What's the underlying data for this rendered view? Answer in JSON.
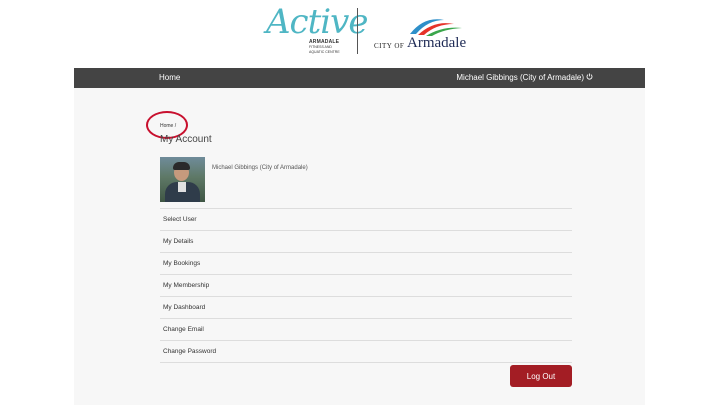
{
  "header": {
    "active_logo": {
      "script": "Active",
      "line1": "ARMADALE",
      "line2": "FITNESS AND",
      "line3": "AQUATIC CENTRE"
    },
    "city_logo": {
      "prefix": "CITY OF",
      "name": "Armadale"
    }
  },
  "nav": {
    "home_label": "Home",
    "user_label": "Michael Gibbings (City of Armadale)",
    "user_icon": "power-icon"
  },
  "main": {
    "breadcrumb": {
      "home": "Home",
      "separator": "/"
    },
    "title": "My Account",
    "profile": {
      "name": "Michael Gibbings (City of Armadale)"
    },
    "menu": [
      {
        "label": "Select User"
      },
      {
        "label": "My Details"
      },
      {
        "label": "My Bookings"
      },
      {
        "label": "My Membership"
      },
      {
        "label": "My Dashboard"
      },
      {
        "label": "Change Email"
      },
      {
        "label": "Change Password"
      }
    ],
    "logout_label": "Log Out"
  },
  "colors": {
    "navbar": "#444444",
    "panel": "#f7f7f7",
    "logout": "#a31d24",
    "annotation": "#c8102e",
    "active_brand": "#4fb6c4",
    "city_brand": "#1e2a55"
  }
}
